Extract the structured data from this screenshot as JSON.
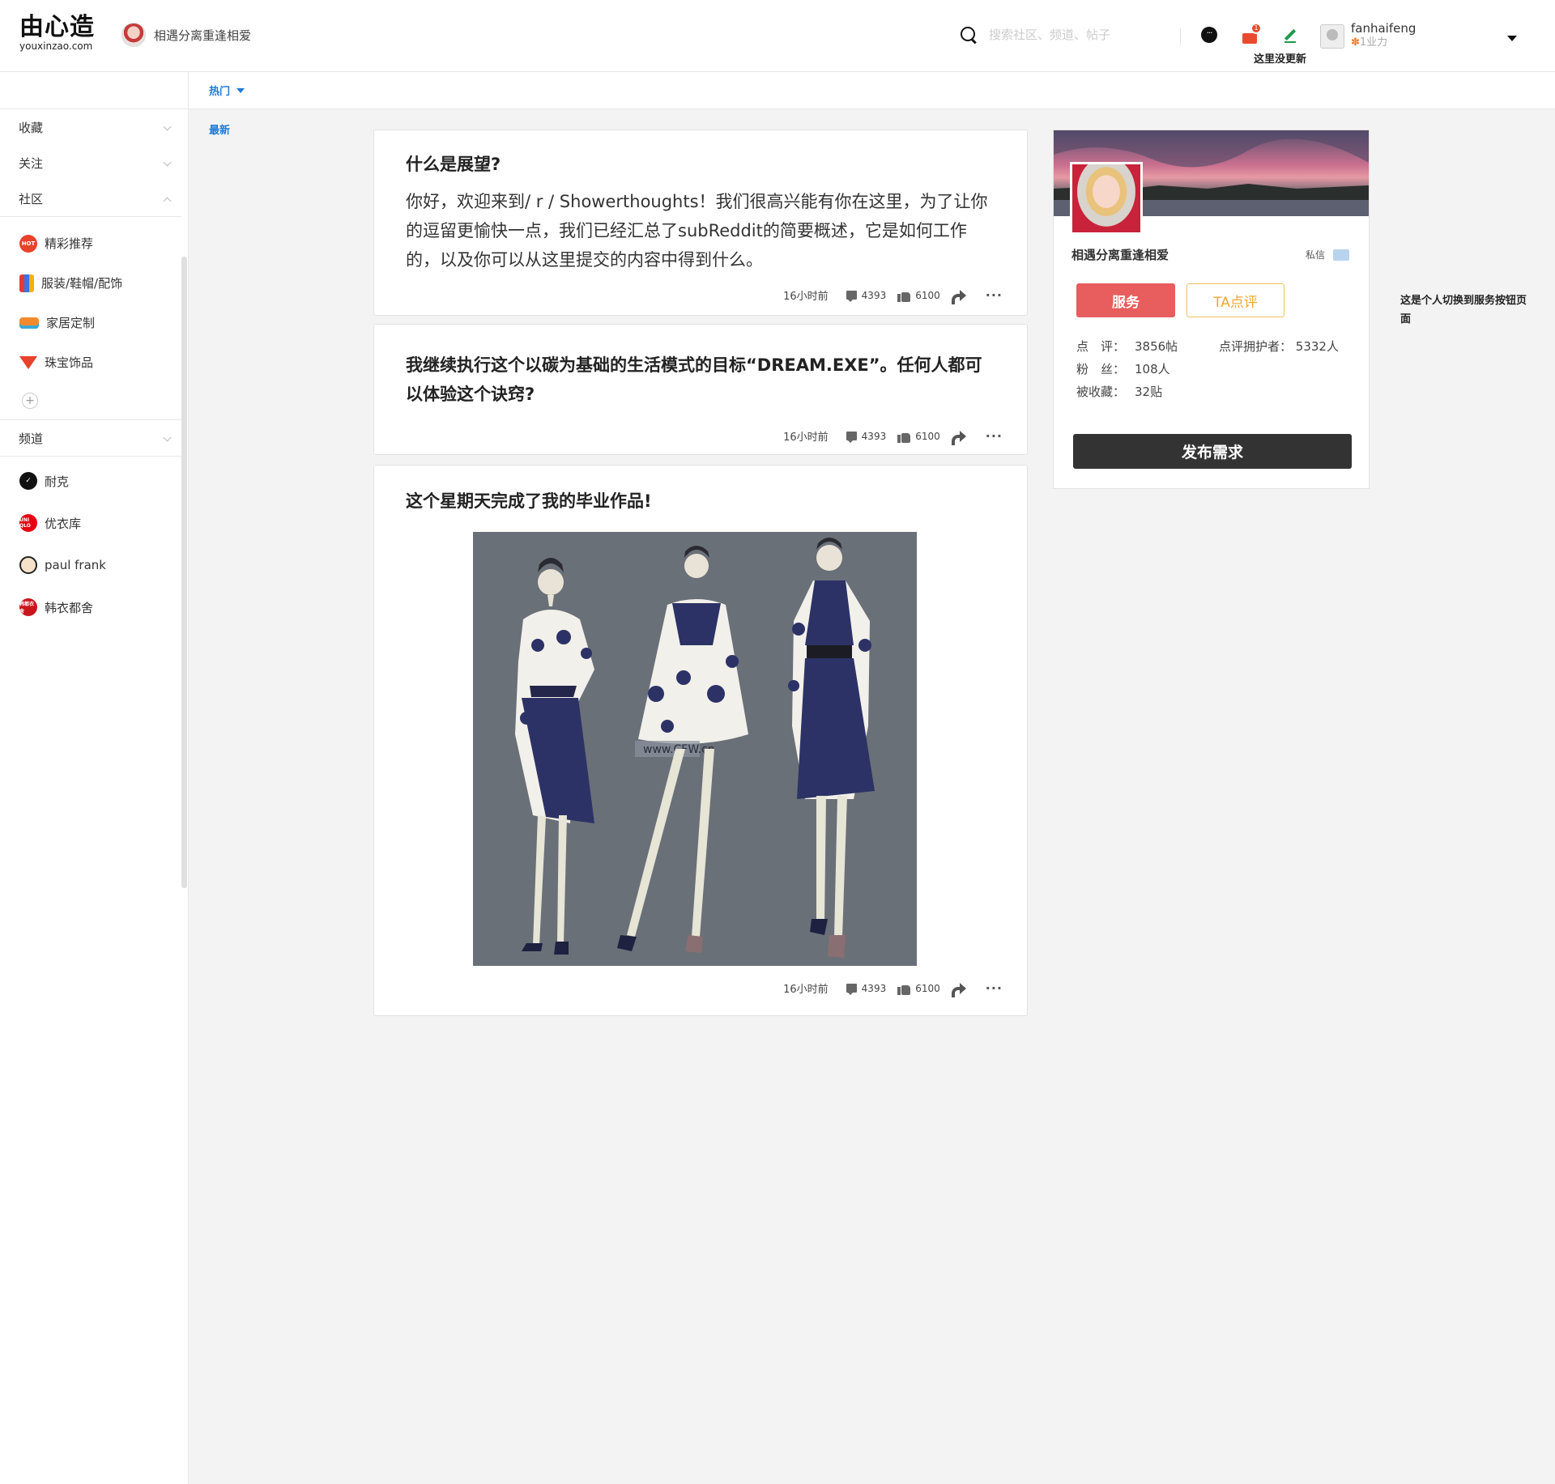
{
  "header": {
    "logo_text": "由心造",
    "logo_domain": "youxinzao.com",
    "community_name": "相遇分离重逢相爱",
    "search_placeholder": "搜索社区、频道、帖子",
    "no_update_label": "这里没更新",
    "mail_badge": "1",
    "user": {
      "name": "fanhaifeng",
      "power": "1业力"
    }
  },
  "tabs": {
    "hot": "热门",
    "new": "最新"
  },
  "sidebar": {
    "sections": {
      "favorites": "收藏",
      "follow": "关注",
      "community": "社区",
      "channel": "频道"
    },
    "communities": [
      {
        "label": "精彩推荐",
        "icon": "hot-icon",
        "icon_text": "HOT"
      },
      {
        "label": "服装/鞋帽/配饰",
        "icon": "clothes-icon"
      },
      {
        "label": "家居定制",
        "icon": "sofa-icon"
      },
      {
        "label": "珠宝饰品",
        "icon": "diamond-icon"
      }
    ],
    "add": "+",
    "channels": [
      {
        "label": "耐克",
        "icon": "nike-logo-icon",
        "icon_text": "✓"
      },
      {
        "label": "优衣库",
        "icon": "uniqlo-logo-icon",
        "icon_text": "UNI QLO"
      },
      {
        "label": "paul frank",
        "icon": "paul-frank-logo-icon",
        "icon_text": "🐵"
      },
      {
        "label": "韩衣都舍",
        "icon": "handu-logo-icon",
        "icon_text": "韩都衣舍"
      }
    ]
  },
  "posts": [
    {
      "title": "什么是展望?",
      "body": "你好，欢迎来到/ r / Showerthoughts！我们很高兴能有你在这里，为了让你的逗留更愉快一点，我们已经汇总了subReddit的简要概述，它是如何工作的，以及你可以从这里提交的内容中得到什么。",
      "time": "16小时前",
      "comments": "4393",
      "likes": "6100",
      "more": "···"
    },
    {
      "title": "我继续执行这个以碳为基础的生活模式的目标“DREAM.EXE”。任何人都可以体验这个诀窍?",
      "time": "16小时前",
      "comments": "4393",
      "likes": "6100",
      "more": "···"
    },
    {
      "title": "这个星期天完成了我的毕业作品!",
      "image_watermark": "www.CFW.cn",
      "time": "16小时前",
      "comments": "4393",
      "likes": "6100",
      "more": "···"
    }
  ],
  "profile_card": {
    "name": "相遇分离重逢相爱",
    "dm_label": "私信",
    "service_button": "服务",
    "review_button": "TA点评",
    "stats": [
      {
        "key": "点　评：",
        "value": "3856帖"
      },
      {
        "key": "粉　丝：",
        "value": "108人"
      },
      {
        "key": "被收藏：",
        "value": "32贴"
      }
    ],
    "guardians_label": "点评拥护者：",
    "guardians_value": "5332人",
    "publish_button": "发布需求"
  },
  "side_note": "这是个人切换到服务按钮页面",
  "colors": {
    "accent_blue": "#1f7ad6",
    "service_red": "#e85d5d",
    "review_orange": "#f0a830",
    "publish_dark": "#333333",
    "fashion_bg": "#6a7078"
  }
}
